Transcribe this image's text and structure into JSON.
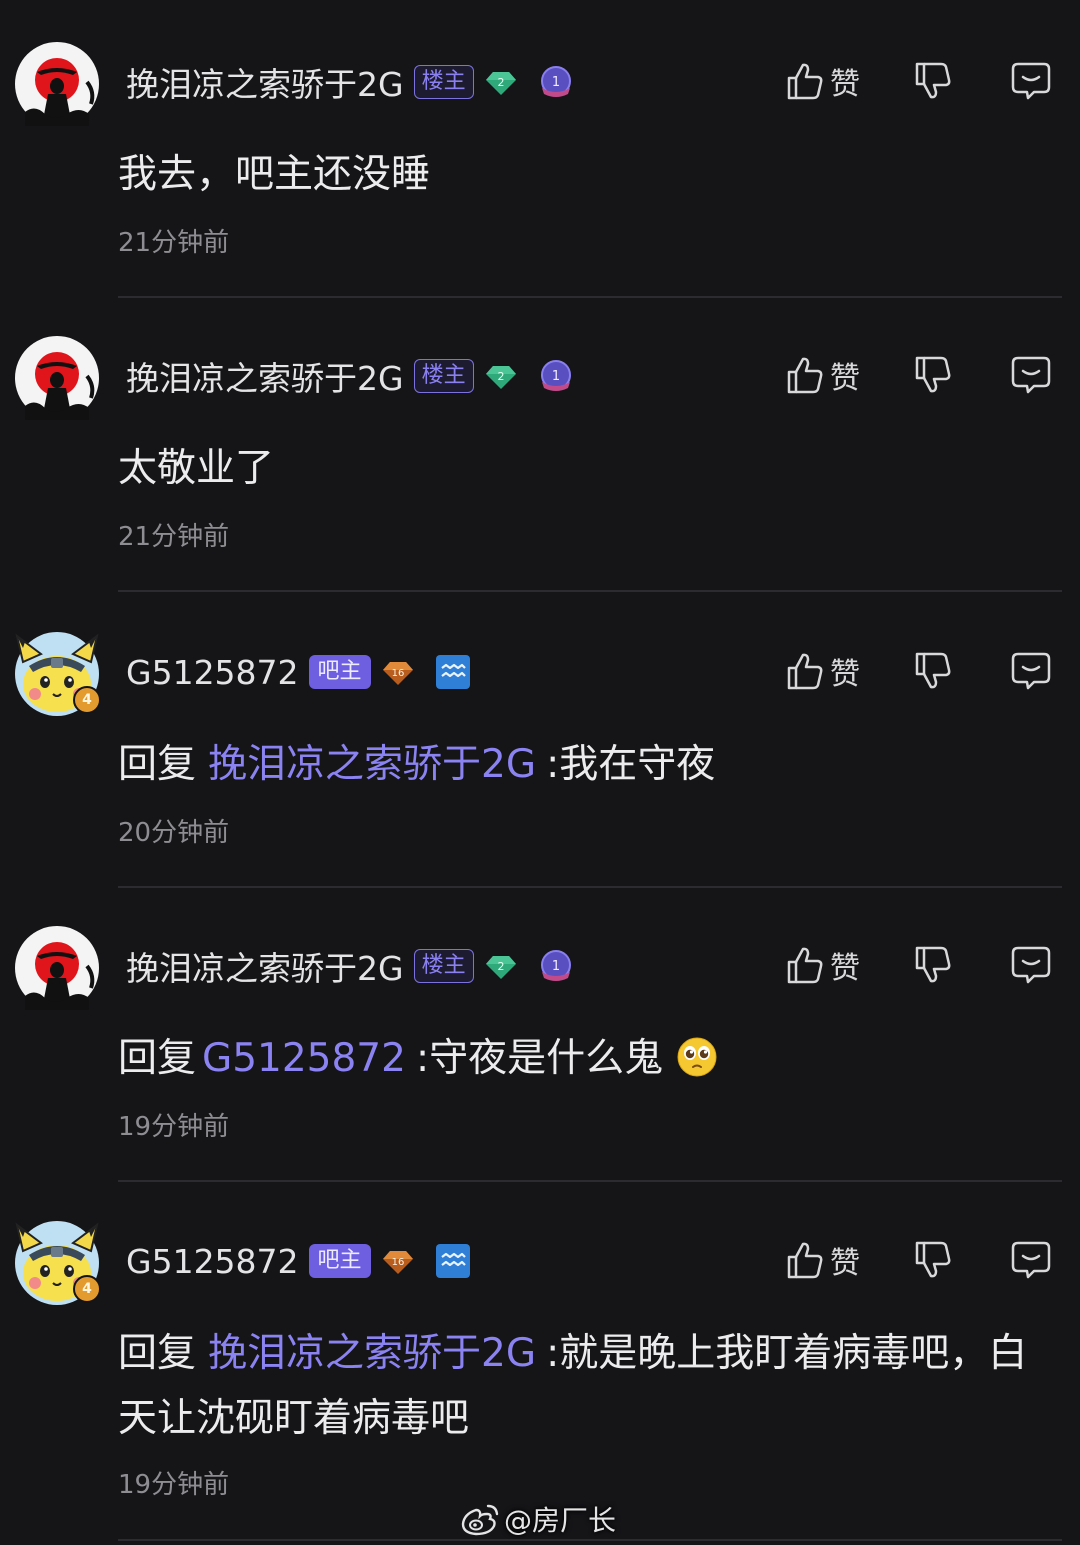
{
  "comments": [
    {
      "username": "挽泪凉之索骄于2G",
      "role": "楼主",
      "gem_level": "2",
      "medal_label": "1",
      "like_label": "赞",
      "text": "我去，吧主还没睡",
      "time": "21分钟前"
    },
    {
      "username": "挽泪凉之索骄于2G",
      "role": "楼主",
      "gem_level": "2",
      "medal_label": "1",
      "like_label": "赞",
      "text": "太敬业了",
      "time": "21分钟前"
    },
    {
      "username": "G5125872",
      "role": "吧主",
      "gem_level": "16",
      "avatar_level": "4",
      "like_label": "赞",
      "reply_prefix": "回复",
      "mention": "挽泪凉之索骄于2G",
      "text": ":我在守夜",
      "time": "20分钟前"
    },
    {
      "username": "挽泪凉之索骄于2G",
      "role": "楼主",
      "gem_level": "2",
      "medal_label": "1",
      "like_label": "赞",
      "reply_prefix": "回复",
      "mention": "G5125872",
      "text": ":守夜是什么鬼",
      "time": "19分钟前"
    },
    {
      "username": "G5125872",
      "role": "吧主",
      "gem_level": "16",
      "avatar_level": "4",
      "like_label": "赞",
      "reply_prefix": "回复",
      "mention": "挽泪凉之索骄于2G",
      "text": ":就是晚上我盯着病毒吧，白",
      "text_line2": "天让沈砚盯着病毒吧",
      "time": "19分钟前"
    }
  ],
  "watermark": {
    "text": "@房厂长"
  },
  "icons": {
    "like": "thumbs-up-icon",
    "dislike": "thumbs-down-icon",
    "reply": "comment-bubble-icon",
    "emoji": "pleading-face-icon",
    "watermark_logo": "weibo-logo-icon"
  },
  "colors": {
    "background": "#151518",
    "mention": "#8c83f2",
    "role_louzhu": "#8a80f0",
    "role_bazhu": "#6e5fe0",
    "gem_green": "#2fa87a",
    "gem_orange": "#d9772a",
    "timestamp": "#8d8d92"
  }
}
